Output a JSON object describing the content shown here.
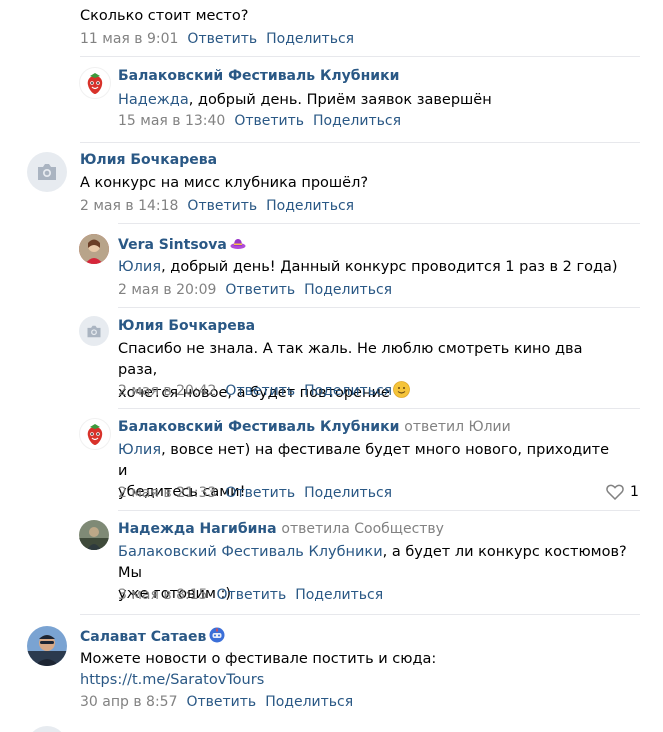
{
  "comments": [
    {
      "text": "Сколько стоит место?",
      "date": "11 мая в 9:01",
      "reply": "Ответить",
      "share": "Поделиться"
    },
    {
      "author": "Балаковский Фестиваль Клубники",
      "mention": "Надежда",
      "text": ", добрый день. Приём заявок завершён",
      "date": "15 мая в 13:40",
      "reply": "Ответить",
      "share": "Поделиться"
    },
    {
      "author": "Юлия Бочкарева",
      "text": "А конкурс на мисс клубника прошёл?",
      "date": "2 мая в 14:18",
      "reply": "Ответить",
      "share": "Поделиться"
    },
    {
      "author": "Vera Sintsova",
      "mention": "Юлия",
      "text": ", добрый день! Данный конкурс проводится 1 раз в 2 года)",
      "date": "2 мая в 20:09",
      "reply": "Ответить",
      "share": "Поделиться"
    },
    {
      "author": "Юлия Бочкарева",
      "line1": "Спасибо не знала. А так жаль. Не люблю смотреть кино два раза,",
      "line2": "хочется новое, а будет повторение",
      "date": "2 мая в 20:42",
      "reply": "Ответить",
      "share": "Поделиться"
    },
    {
      "author": "Балаковский Фестиваль Клубники",
      "replied": "ответил Юлии",
      "mention": "Юлия",
      "line1": ", вовсе нет) на фестивале будет много нового, приходите и",
      "line2": "убедитесь сами!",
      "date": "2 мая в 21:33",
      "reply": "Ответить",
      "share": "Поделиться",
      "likes": "1"
    },
    {
      "author": "Надежда Нагибина",
      "replied": "ответила Сообществу",
      "mention": "Балаковский Фестиваль Клубники",
      "line1": ", а будет ли конкурс костюмов? Мы",
      "line2": "уже готовим :)",
      "date": "3 мая в 8:15",
      "reply": "Ответить",
      "share": "Поделиться"
    },
    {
      "author": "Салават Сатаев",
      "line1": "Можете новости о фестивале постить и сюда:",
      "link": "https://t.me/SaratovTours",
      "date": "30 апр в 8:57",
      "reply": "Ответить",
      "share": "Поделиться"
    }
  ],
  "icons": {
    "camera": "camera-icon",
    "heart": "heart-icon",
    "smile": "smile-emoji-icon",
    "strawberry": "strawberry-logo-icon"
  },
  "colors": {
    "link": "#2a5885",
    "meta": "#828282",
    "separator": "#e7e8ec"
  }
}
